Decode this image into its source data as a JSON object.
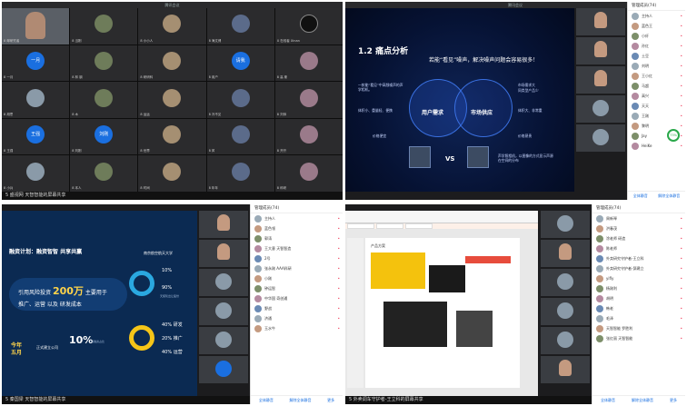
{
  "panels": {
    "p1": {
      "title": "腾讯会议",
      "status": "5 盛视网 天智智能的屏幕共享",
      "tiles": [
        {
          "name": "8 邮研究者"
        },
        {
          "name": "8 当刚"
        },
        {
          "name": "8 小小人"
        },
        {
          "name": "8 海文博"
        },
        {
          "name": "X 在线者 Xinan"
        },
        {
          "name": "8 一月",
          "label": "一月"
        },
        {
          "name": "8 林 钢"
        },
        {
          "name": "8 研研科"
        },
        {
          "name": "8 用户",
          "label": "请我"
        },
        {
          "name": "8 高 斯"
        },
        {
          "name": "8 胡思"
        },
        {
          "name": "8 木"
        },
        {
          "name": "8 运运"
        },
        {
          "name": "8 冷不见"
        },
        {
          "name": "8 刘帅"
        },
        {
          "name": "8 王强",
          "label": "王强"
        },
        {
          "name": "8 刘刚",
          "label": "刘刚"
        },
        {
          "name": "8 世界"
        },
        {
          "name": "8 风"
        },
        {
          "name": "8 开开"
        },
        {
          "name": "8 小兵"
        },
        {
          "name": "8 本人"
        },
        {
          "name": "8 时间"
        },
        {
          "name": "8 年年"
        },
        {
          "name": "8 科研"
        }
      ]
    },
    "p2": {
      "title": "腾讯会议",
      "slide_title": "1.2 痛点分析",
      "question": "若能“看见”噪声，解决噪声问题会容易很多！",
      "left_circle": "用户需求",
      "right_circle": "市场供应",
      "l1": "一款能“看见”中高频噪声的声学相机。",
      "l2": "体积小、重量轻、便携",
      "l3": "价格便宜",
      "r1": "市场需求大",
      "r2": "同类型产品少",
      "r3": "体积大、非常重",
      "r4": "价格昂贵",
      "r5": "声学照相机，以图像的方式显示声源在空间的分布",
      "vs": "VS",
      "status": "",
      "member_head": "管理成员(74)",
      "members": [
        "主持人",
        "蓝色王",
        "小纤",
        "孙红",
        "土豆",
        "刘明",
        "王小红",
        "马超",
        "高兴",
        "天天",
        "王刚",
        "黎明",
        "Jay",
        "HeiKe"
      ],
      "badge": "73%",
      "footer": [
        "全体静音",
        "解除全体静音",
        "更多"
      ]
    },
    "p3": {
      "title": "融资计划：融资智智 共享共赢",
      "university": "南京航空航天大学",
      "big_prefix": "引用风险投资",
      "big_value": "200万",
      "big_suffix": "主要用于",
      "sub": "推广、运营 以及 研发成本",
      "year": "今年\n五月",
      "year_note": "正式建立公司",
      "pct_top": [
        "10%",
        "90%"
      ],
      "pct_top_note": "天使轮出让股份",
      "pct_mid": "10%",
      "pct_mid_note": "拟融资占比",
      "pct_bottom": [
        "40% 研发",
        "20% 推广",
        "40% 运营"
      ],
      "status": "5 秦国梁 天智智能的屏幕共享",
      "member_head": "管理成员(74)",
      "members": [
        "主持人",
        "蓝色领",
        "郭涛",
        "王大意 天智智造",
        "2号",
        "张永刚 AAA科研",
        "小刚",
        "钟运智",
        "中华国 奇创通",
        "野战",
        "济通",
        "玉水牛"
      ],
      "footer": [
        "全体静音",
        "解除全体静音",
        "更多"
      ]
    },
    "p4": {
      "title": "产品方案",
      "status": "5 外卖调车守护者-王立科的屏幕共享",
      "member_head": "管理成员(74)",
      "members": [
        "周新琴",
        "洪春茂",
        "涂老师 研造",
        "陈老师",
        "外卖研究守护者-王立科",
        "外卖研究守护者-邱建立",
        "yifly",
        "杨刚利",
        "胡明",
        "韩老",
        "毛泽",
        "天智智能 罗胜利",
        "张红丽 天智智能"
      ],
      "footer": [
        "全体静音",
        "解除全体静音",
        "更多"
      ]
    }
  }
}
